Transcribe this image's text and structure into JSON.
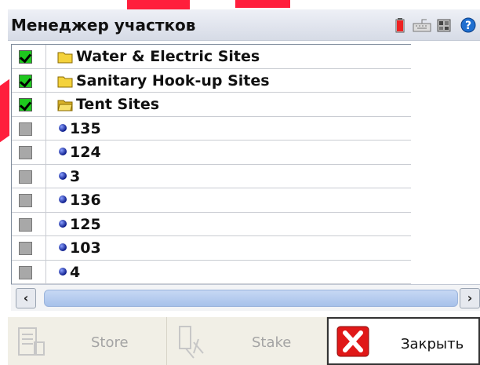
{
  "window": {
    "title": "Менеджер участков"
  },
  "toolbar_icons": [
    "battery-icon",
    "keyboard-icon",
    "settings-icon",
    "help-icon"
  ],
  "list": {
    "rows": [
      {
        "label": "Water & Electric Sites",
        "checked": true,
        "icon": "folder-icon"
      },
      {
        "label": "Sanitary Hook-up Sites",
        "checked": true,
        "icon": "folder-icon"
      },
      {
        "label": "Tent Sites",
        "checked": true,
        "icon": "folder-open-icon"
      },
      {
        "label": "135",
        "checked": false,
        "icon": "point-icon"
      },
      {
        "label": "124",
        "checked": false,
        "icon": "point-icon"
      },
      {
        "label": "3",
        "checked": false,
        "icon": "point-icon"
      },
      {
        "label": "136",
        "checked": false,
        "icon": "point-icon"
      },
      {
        "label": "125",
        "checked": false,
        "icon": "point-icon"
      },
      {
        "label": "103",
        "checked": false,
        "icon": "point-icon"
      },
      {
        "label": "4",
        "checked": false,
        "icon": "point-icon"
      }
    ]
  },
  "buttons": {
    "store": "Store",
    "stake": "Stake",
    "close": "Закрыть"
  },
  "colors": {
    "check_on": "#1ec81e",
    "check_off": "#a8a8a8",
    "scroll_thumb": "#b5cbee",
    "close_red": "#e01818"
  }
}
